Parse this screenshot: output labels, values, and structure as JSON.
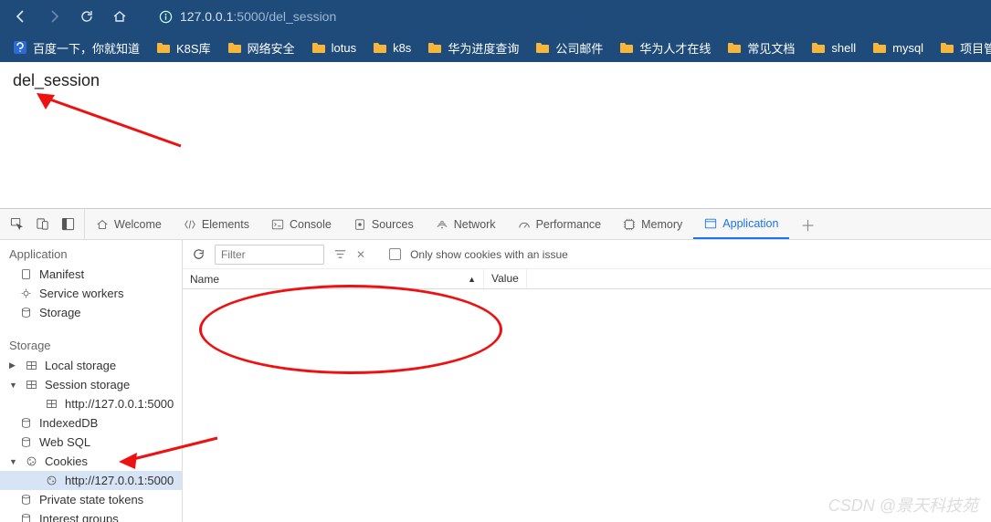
{
  "browser": {
    "url_host": "127.0.0.1",
    "url_path": ":5000/del_session",
    "bookmarks": [
      "百度一下，你就知道",
      "K8S库",
      "网络安全",
      "lotus",
      "k8s",
      "华为进度查询",
      "公司邮件",
      "华为人才在线",
      "常见文档",
      "shell",
      "mysql",
      "项目管理"
    ]
  },
  "page_text": "del_session",
  "devtools": {
    "tabs": {
      "welcome": "Welcome",
      "elements": "Elements",
      "console": "Console",
      "sources": "Sources",
      "network": "Network",
      "performance": "Performance",
      "memory": "Memory",
      "application": "Application"
    },
    "sidebar": {
      "app_header": "Application",
      "app_items": [
        "Manifest",
        "Service workers",
        "Storage"
      ],
      "storage_header": "Storage",
      "local_storage": "Local storage",
      "session_storage": "Session storage",
      "session_origin": "http://127.0.0.1:5000",
      "indexeddb": "IndexedDB",
      "websql": "Web SQL",
      "cookies": "Cookies",
      "cookies_origin": "http://127.0.0.1:5000",
      "private_tokens": "Private state tokens",
      "interest_groups": "Interest groups"
    },
    "toolbar": {
      "filter_placeholder": "Filter",
      "only_issue": "Only show cookies with an issue"
    },
    "columns": {
      "name": "Name",
      "value": "Value"
    }
  },
  "watermark": "CSDN @景天科技苑"
}
